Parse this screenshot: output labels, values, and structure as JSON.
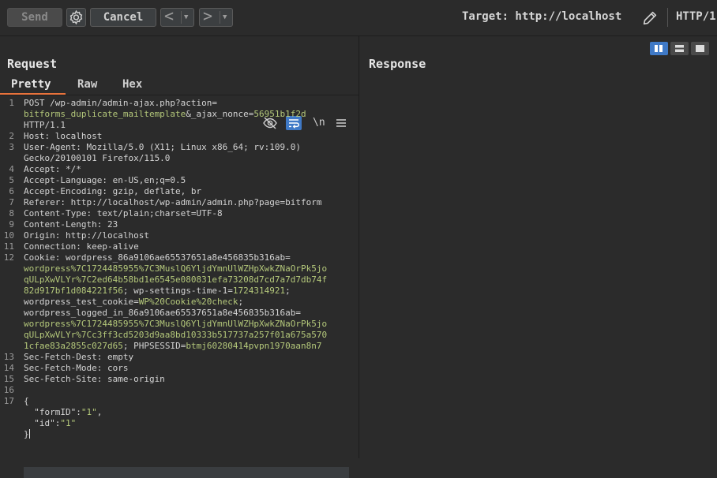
{
  "toolbar": {
    "send_label": "Send",
    "cancel_label": "Cancel",
    "back_glyph": "<",
    "forward_glyph": ">",
    "dropdown_glyph": "▼",
    "target_label": "Target: http://localhost",
    "http_label": "HTTP/1"
  },
  "request": {
    "title": "Request",
    "tabs": [
      "Pretty",
      "Raw",
      "Hex"
    ],
    "active_tab": "Pretty",
    "newline_toggle": "\\n",
    "lines": [
      {
        "n": "1",
        "parts": [
          "POST /wp-admin/admin-ajax.php?action="
        ]
      },
      {
        "n": "",
        "parts": [
          "",
          "bitforms_duplicate_mailtemplate",
          "&_ajax_nonce=",
          "56951b1f2d"
        ]
      },
      {
        "n": "",
        "parts": [
          "HTTP/1.1"
        ]
      },
      {
        "n": "2",
        "parts": [
          "Host: localhost"
        ]
      },
      {
        "n": "3",
        "parts": [
          "User-Agent: Mozilla/5.0 (X11; Linux x86_64; rv:109.0)"
        ]
      },
      {
        "n": "",
        "parts": [
          "Gecko/20100101 Firefox/115.0"
        ]
      },
      {
        "n": "4",
        "parts": [
          "Accept: */*"
        ]
      },
      {
        "n": "5",
        "parts": [
          "Accept-Language: en-US,en;q=0.5"
        ]
      },
      {
        "n": "6",
        "parts": [
          "Accept-Encoding: gzip, deflate, br"
        ]
      },
      {
        "n": "7",
        "parts": [
          "Referer: http://localhost/wp-admin/admin.php?page=bitform"
        ]
      },
      {
        "n": "8",
        "parts": [
          "Content-Type: text/plain;charset=UTF-8"
        ]
      },
      {
        "n": "9",
        "parts": [
          "Content-Length: 23"
        ]
      },
      {
        "n": "10",
        "parts": [
          "Origin: http://localhost"
        ]
      },
      {
        "n": "11",
        "parts": [
          "Connection: keep-alive"
        ]
      },
      {
        "n": "12",
        "parts": [
          "Cookie: wordpress_86a9106ae65537651a8e456835b316ab="
        ]
      },
      {
        "n": "",
        "parts": [
          "",
          "wordpress%7C1724485955%7C3MuslQ6YljdYmnUlWZHpXwkZNaOrPk5jo"
        ]
      },
      {
        "n": "",
        "parts": [
          "",
          "qULpXwVLYr%7C2ed64b58bd1e6545e080831efa73208d7cd7a7d7db74f"
        ]
      },
      {
        "n": "",
        "parts": [
          "",
          "82d917bf1d084221f56",
          "; wp-settings-time-1=",
          "1724314921",
          ";"
        ]
      },
      {
        "n": "",
        "parts": [
          "wordpress_test_cookie=",
          "WP%20Cookie%20check",
          ";"
        ]
      },
      {
        "n": "",
        "parts": [
          "wordpress_logged_in_86a9106ae65537651a8e456835b316ab="
        ]
      },
      {
        "n": "",
        "parts": [
          "",
          "wordpress%7C1724485955%7C3MuslQ6YljdYmnUlWZHpXwkZNaOrPk5jo"
        ]
      },
      {
        "n": "",
        "parts": [
          "",
          "qULpXwVLYr%7Cc3ff3cd5203d9aa8bd10333b517737a257f01a675a570"
        ]
      },
      {
        "n": "",
        "parts": [
          "",
          "1cfae83a2855c027d65",
          "; PHPSESSID=",
          "btmj60280414pvpn1970aan8n7"
        ]
      },
      {
        "n": "13",
        "parts": [
          "Sec-Fetch-Dest: empty"
        ]
      },
      {
        "n": "14",
        "parts": [
          "Sec-Fetch-Mode: cors"
        ]
      },
      {
        "n": "15",
        "parts": [
          "Sec-Fetch-Site: same-origin"
        ]
      },
      {
        "n": "16",
        "parts": [
          ""
        ]
      },
      {
        "n": "17",
        "parts": [
          "{"
        ]
      },
      {
        "n": "",
        "parts": [
          "  \"formID\":",
          "\"1\"",
          ","
        ]
      },
      {
        "n": "",
        "parts": [
          "  \"id\":",
          "\"1\""
        ]
      },
      {
        "n": "",
        "parts": [
          "}"
        ]
      }
    ]
  },
  "response": {
    "title": "Response"
  },
  "colors": {
    "accent_tab": "#e8733c",
    "active_toggle": "#3f79c6",
    "value_green": "#b5c97b"
  },
  "icons": [
    "settings-gear-icon",
    "pencil-edit-icon",
    "hide-eye-icon",
    "wrap-lines-icon",
    "menu-icon",
    "split-horizontal-icon",
    "split-vertical-icon",
    "single-pane-icon"
  ]
}
